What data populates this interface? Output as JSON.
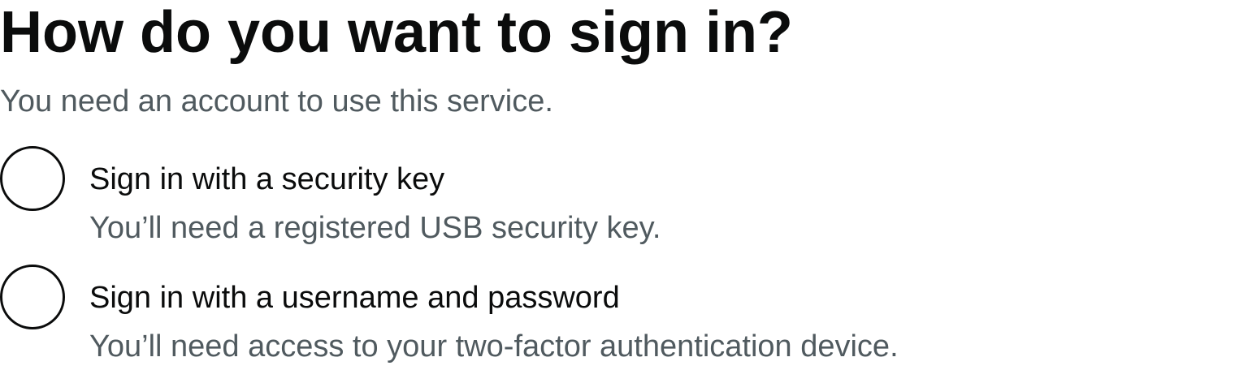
{
  "page": {
    "title": "How do you want to sign in?",
    "hint": "You need an account to use this service."
  },
  "options": [
    {
      "label": "Sign in with a security key",
      "hint": "You’ll need a registered USB security key.",
      "selected": false
    },
    {
      "label": "Sign in with a username and password",
      "hint": "You’ll need access to your two-factor authentication device.",
      "selected": false
    }
  ],
  "colors": {
    "text": "#0b0c0c",
    "secondary_text": "#505a5f",
    "background": "#ffffff"
  }
}
